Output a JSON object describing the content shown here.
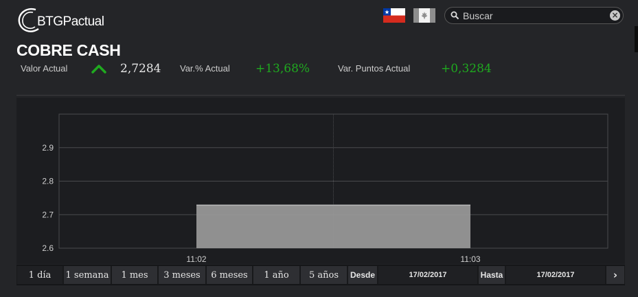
{
  "brand": {
    "logo_text": "BTGPactual"
  },
  "header": {
    "search": {
      "placeholder": "Buscar"
    }
  },
  "title": "COBRE CASH",
  "stats": {
    "valor_actual_label": "Valor Actual",
    "valor_actual": "2,7284",
    "var_pct_label": "Var.% Actual",
    "var_pct": "+13,68%",
    "var_puntos_label": "Var. Puntos Actual",
    "var_puntos": "+0,3284"
  },
  "colors": {
    "positive": "#1faa1f",
    "bar_fill": "#9a9a9a",
    "background": "#242528",
    "plot_background": "#1c1d20",
    "grid": "#4a4b4e"
  },
  "icons": {
    "trend": "up-arrow-icon",
    "search": "search-icon",
    "clear": "clear-icon",
    "next": "chevron-right-icon"
  },
  "chart_data": {
    "type": "area",
    "x": [
      "11:02",
      "11:03"
    ],
    "values": [
      2.7284,
      2.7284
    ],
    "baseline": 2.6,
    "yticks": [
      2.6,
      2.7,
      2.8,
      2.9
    ],
    "ylim": [
      2.6,
      3.0
    ],
    "grid": true
  },
  "range": {
    "buttons": [
      "1 día",
      "1 semana",
      "1 mes",
      "3 meses",
      "6 meses",
      "1 año",
      "5 años"
    ],
    "selected": "1 día",
    "desde_label": "Desde",
    "desde_value": "17/02/2017",
    "hasta_label": "Hasta",
    "hasta_value": "17/02/2017",
    "next_label": "›"
  }
}
